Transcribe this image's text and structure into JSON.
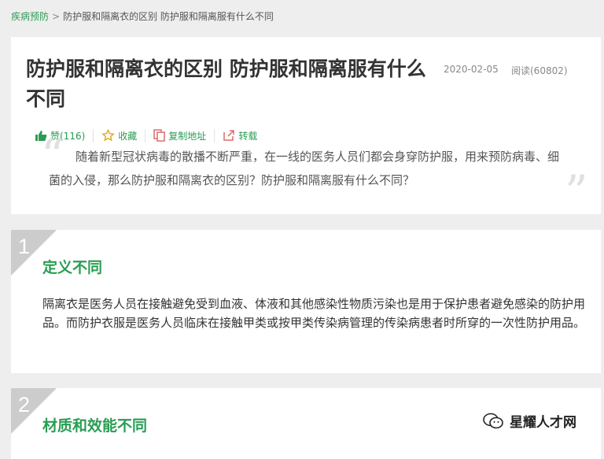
{
  "breadcrumb": {
    "category": "疾病预防",
    "separator": ">",
    "current": "防护服和隔离衣的区别 防护服和隔离服有什么不同"
  },
  "article": {
    "title": "防护服和隔离衣的区别 防护服和隔离服有什么不同",
    "date": "2020-02-05",
    "reads": "阅读(60802)",
    "actions": {
      "like": "赞(116)",
      "favorite": "收藏",
      "copy": "复制地址",
      "share": "转载"
    },
    "summary": "随着新型冠状病毒的散播不断严重，在一线的医务人员们都会身穿防护服，用来预防病毒、细菌的入侵，那么防护服和隔离衣的区别？防护服和隔离服有什么不同？"
  },
  "sections": [
    {
      "number": "1",
      "title": "定义不同",
      "body": "隔离衣是医务人员在接触避免受到血液、体液和其他感染性物质污染也是用于保护患者避免感染的防护用品。而防护衣服是医务人员临床在接触甲类或按甲类传染病管理的传染病患者时所穿的一次性防护用品。"
    },
    {
      "number": "2",
      "title": "材质和效能不同"
    }
  ],
  "watermark": "星耀人才网",
  "colors": {
    "accent": "#2a9d54",
    "background": "#eeeeee",
    "number_badge": "#cccccc"
  }
}
